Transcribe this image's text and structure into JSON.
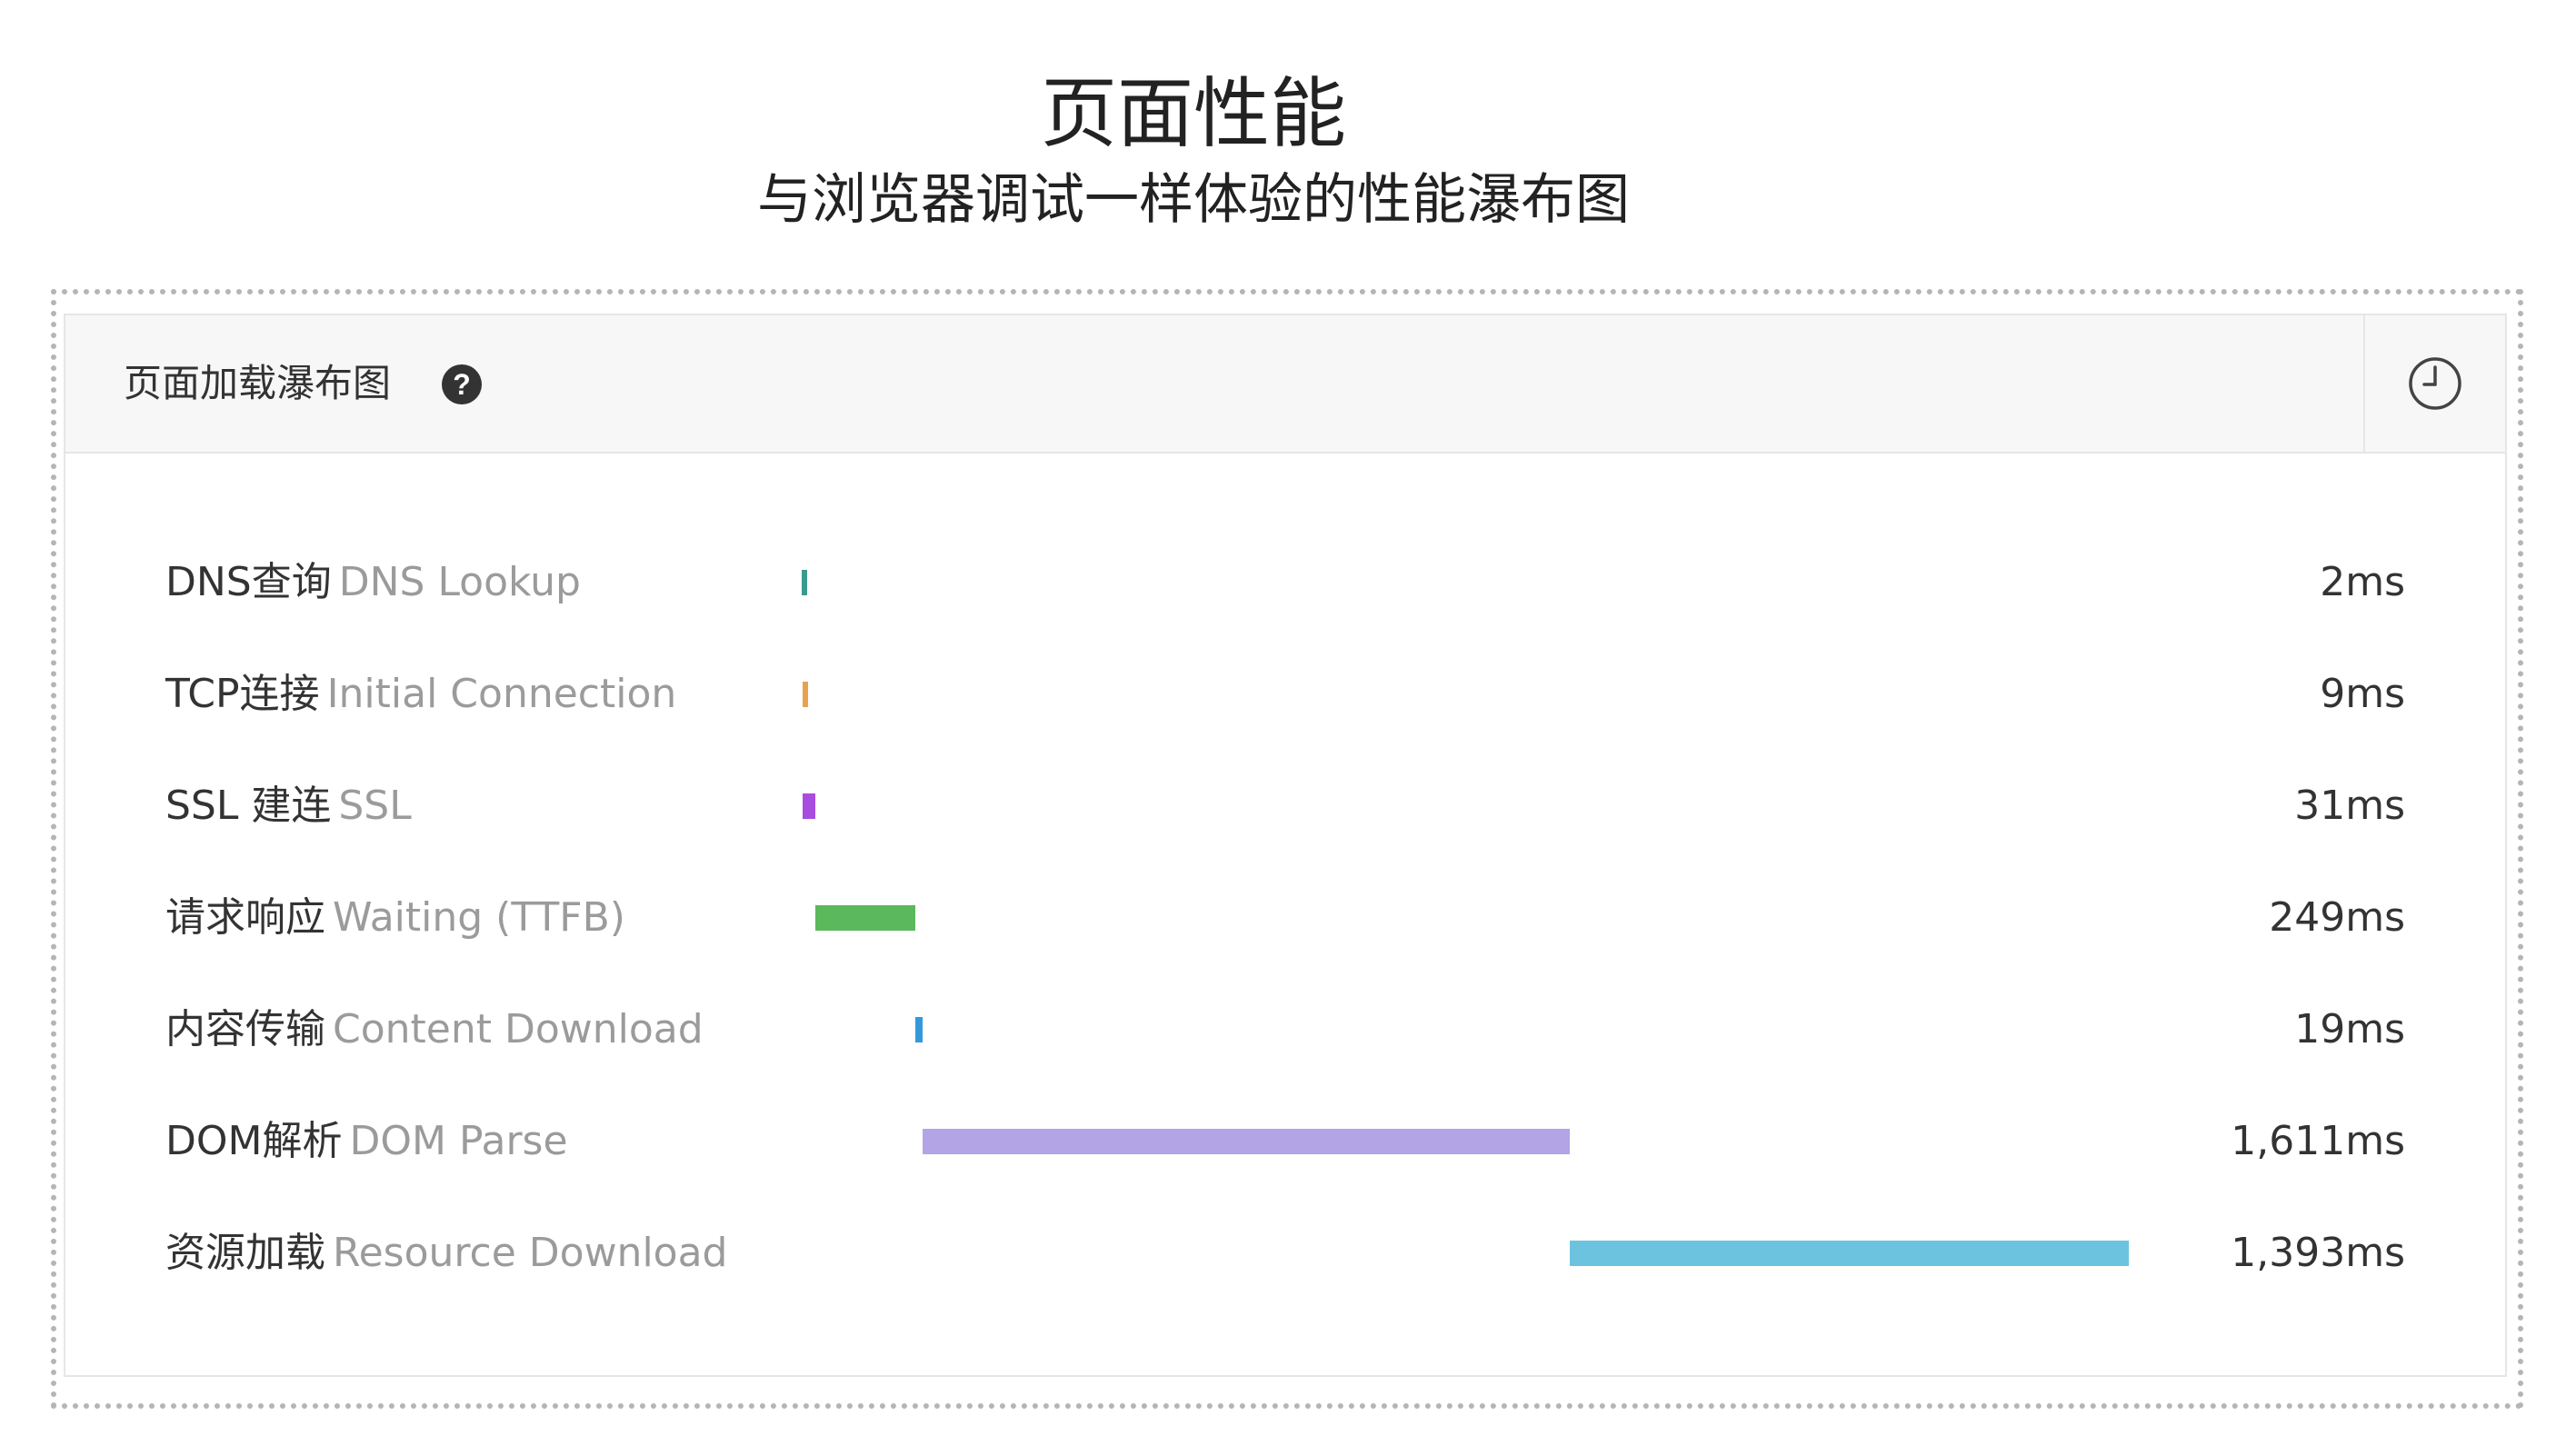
{
  "header": {
    "title": "页面性能",
    "subtitle": "与浏览器调试一样体验的性能瀑布图"
  },
  "panel": {
    "title": "页面加载瀑布图",
    "help_icon": "question-circle-icon",
    "history_icon": "clock-icon"
  },
  "chart_data": {
    "type": "bar",
    "subtype": "waterfall",
    "title": "页面加载瀑布图",
    "unit": "ms",
    "total_ms": 3314,
    "rows": [
      {
        "label_cn": "DNS查询",
        "label_en": "DNS Lookup",
        "start": 0,
        "duration": 2,
        "display": "2ms",
        "color": "#3a9a8f"
      },
      {
        "label_cn": "TCP连接",
        "label_en": "Initial Connection",
        "start": 2,
        "duration": 9,
        "display": "9ms",
        "color": "#e8a24e"
      },
      {
        "label_cn": "SSL 建连",
        "label_en": "SSL",
        "start": 2,
        "duration": 31,
        "display": "31ms",
        "color": "#a84de0"
      },
      {
        "label_cn": "请求响应",
        "label_en": "Waiting (TTFB)",
        "start": 33,
        "duration": 249,
        "display": "249ms",
        "color": "#5cb85c"
      },
      {
        "label_cn": "内容传输",
        "label_en": "Content Download",
        "start": 282,
        "duration": 19,
        "display": "19ms",
        "color": "#3498db"
      },
      {
        "label_cn": "DOM解析",
        "label_en": "DOM Parse",
        "start": 301,
        "duration": 1611,
        "display": "1,611ms",
        "color": "#b3a4e6"
      },
      {
        "label_cn": "资源加载",
        "label_en": "Resource Download",
        "start": 1912,
        "duration": 1393,
        "display": "1,393ms",
        "color": "#6cc3e0"
      }
    ]
  }
}
